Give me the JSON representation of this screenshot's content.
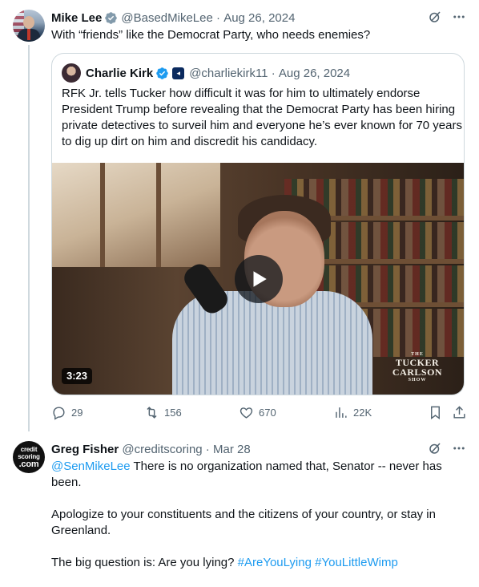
{
  "tweet1": {
    "author_name": "Mike Lee",
    "handle": "@BasedMikeLee",
    "date": "Aug 26, 2024",
    "text": "With “friends” like the Democrat Party, who needs enemies?",
    "quote": {
      "author_name": "Charlie Kirk",
      "handle": "@charliekirk11",
      "date": "Aug 26, 2024",
      "text": "RFK Jr. tells Tucker how difficult it was for him to ultimately endorse President Trump before revealing that the Democrat Party has been hiring private detectives to surveil him and everyone he’s ever known for 70 years to dig up dirt on him and discredit his candidacy.",
      "video": {
        "duration": "3:23",
        "brand_line1": "THE",
        "brand_line2": "TUCKER CARLSON",
        "brand_line3": "SHOW"
      }
    },
    "stats": {
      "replies": "29",
      "reposts": "156",
      "likes": "670",
      "views": "22K"
    }
  },
  "tweet2": {
    "author_name": "Greg Fisher",
    "handle": "@creditscoring",
    "date": "Mar 28",
    "avatar_lines": [
      "credit",
      "scoring",
      ".com"
    ],
    "mention": "@SenMikeLee",
    "text_p1": " There is no organization named that, Senator -- never has been.",
    "text_p2": "Apologize to your constituents and the citizens of your country, or stay in Greenland.",
    "text_p3_prefix": "The big question is: Are you lying? ",
    "hashtag1": "#AreYouLying",
    "hashtag2": "#YouLittleWimp"
  },
  "colors": {
    "accent": "#1d9bf0",
    "muted": "#536471",
    "border": "#cfd9de"
  },
  "icons": [
    "verified-badge-icon",
    "grok-icon",
    "more-icon",
    "reply-icon",
    "repost-icon",
    "like-icon",
    "views-icon",
    "bookmark-icon",
    "share-icon",
    "play-icon"
  ]
}
